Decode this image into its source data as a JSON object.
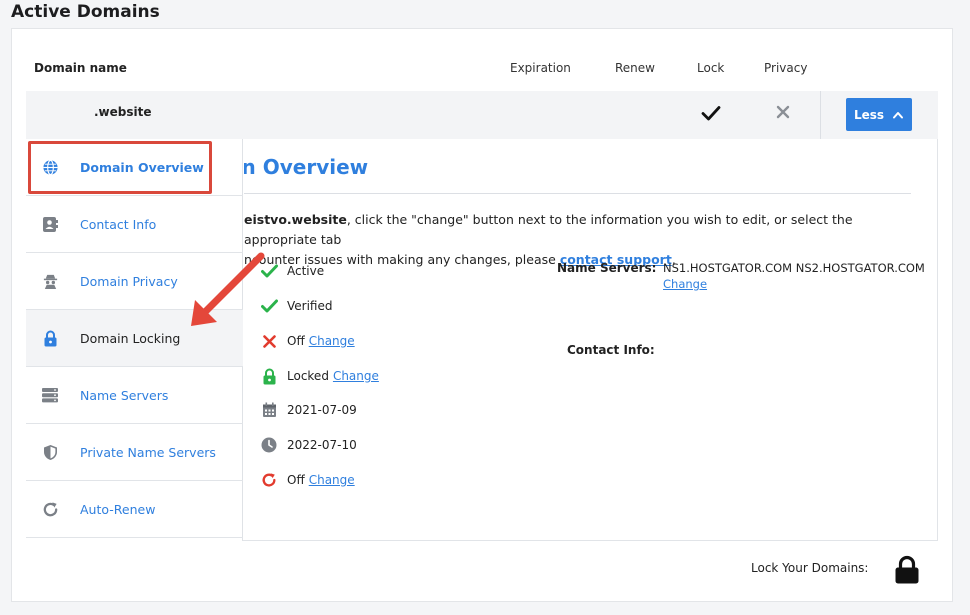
{
  "page": {
    "title": "Active Domains"
  },
  "table": {
    "headers": {
      "domain": "Domain name",
      "expiration": "Expiration",
      "renew": "Renew",
      "lock": "Lock",
      "privacy": "Privacy"
    },
    "row": {
      "domain": ".website",
      "lock_icon": "checkmark-icon",
      "privacy_icon": "x-icon",
      "toggle_label": "Less"
    }
  },
  "sidebar": {
    "items": [
      {
        "label": "Domain Overview",
        "icon": "globe-icon"
      },
      {
        "label": "Contact Info",
        "icon": "contact-card-icon"
      },
      {
        "label": "Domain Privacy",
        "icon": "spy-icon"
      },
      {
        "label": "Domain Locking",
        "icon": "lock-icon"
      },
      {
        "label": "Name Servers",
        "icon": "server-icon"
      },
      {
        "label": "Private Name Servers",
        "icon": "shield-icon"
      },
      {
        "label": "Auto-Renew",
        "icon": "refresh-icon"
      }
    ]
  },
  "overview": {
    "title": "Domain Overview",
    "intro_domain": "eistvo.website",
    "intro_line1": ", click the \"change\" button next to the information you wish to edit, or select the appropriate tab",
    "intro_line2_a": "ncounter issues with making any changes, please ",
    "intro_link": "contact support",
    "intro_line2_b": ".",
    "statuses": [
      {
        "icon": "check-icon",
        "text": "Active",
        "change": ""
      },
      {
        "icon": "check-icon",
        "text": "Verified",
        "change": ""
      },
      {
        "icon": "x-icon",
        "text": "Off",
        "change": "Change"
      },
      {
        "icon": "lock-icon",
        "text": "Locked",
        "change": "Change"
      },
      {
        "icon": "calendar-icon",
        "text": "2021-07-09",
        "change": ""
      },
      {
        "icon": "clock-icon",
        "text": "2022-07-10",
        "change": ""
      },
      {
        "icon": "refresh-icon",
        "text": "Off",
        "change": "Change"
      }
    ],
    "name_servers_label": "Name Servers:",
    "name_servers_value": "NS1.HOSTGATOR.COM NS2.HOSTGATOR.COM",
    "name_servers_change": "Change",
    "contact_info_label": "Contact Info:"
  },
  "footer": {
    "lock_label": "Lock Your Domains:",
    "lock_icon": "padlock-icon"
  },
  "colors": {
    "accent": "#2f7fde",
    "success": "#2bb34b",
    "danger": "#e23b2e",
    "highlight": "#d9483b"
  }
}
